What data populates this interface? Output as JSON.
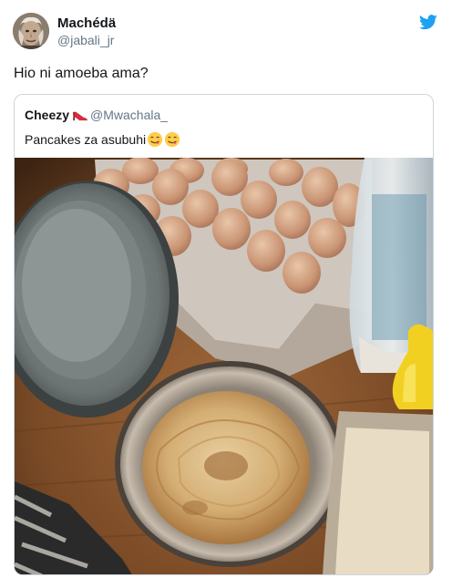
{
  "author": {
    "display_name": "Machédä",
    "handle": "@jabali_jr",
    "avatar": "avatar-photo"
  },
  "tweet": {
    "text": "Hio ni amoeba ama?"
  },
  "quoted_tweet": {
    "display_name": "Cheezy",
    "name_emoji": "high-heel-shoe-icon",
    "handle": "@Mwachala_",
    "text": "Pancakes za asubuhi",
    "text_emojis": [
      "face-savoring-food-icon",
      "face-savoring-food-icon"
    ],
    "image": "photo of pancakes in a steel plate next to a tray of eggs"
  },
  "icons": {
    "brand": "twitter-bird-icon"
  },
  "colors": {
    "twitter_blue": "#1da1f2",
    "text_primary": "#14171a",
    "text_secondary": "#657786",
    "border": "#ccd6dd"
  }
}
